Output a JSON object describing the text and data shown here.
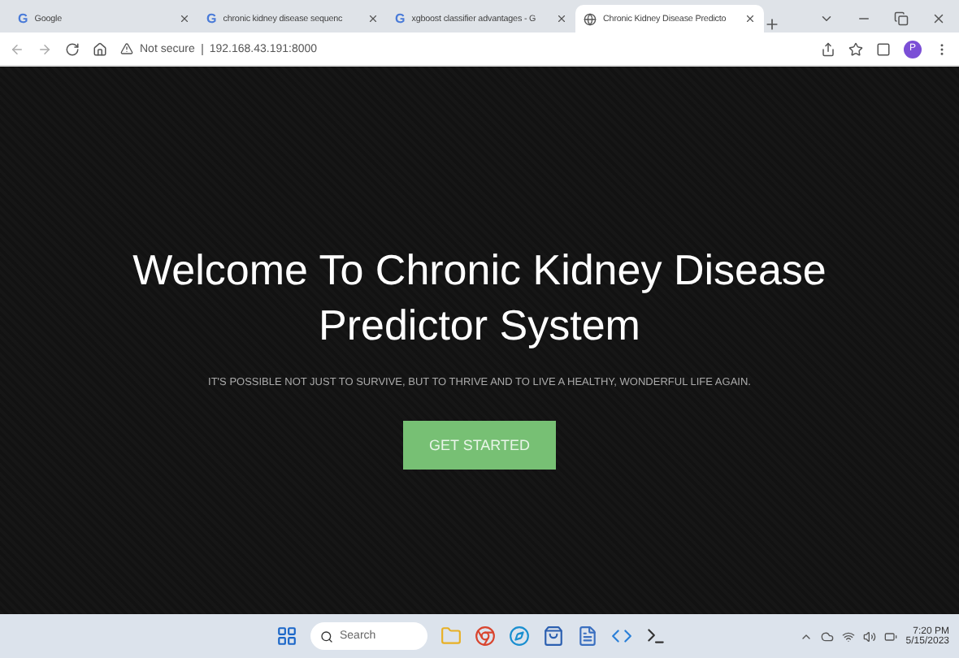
{
  "browser": {
    "tabs": [
      {
        "kind": "search",
        "favicon": "G",
        "title": "Google",
        "selected": false
      },
      {
        "kind": "search",
        "favicon": "G",
        "title": "chronic kidney disease sequenc",
        "selected": false
      },
      {
        "kind": "search",
        "favicon": "G",
        "title": "xgboost classifier advantages - G",
        "selected": false
      },
      {
        "kind": "site",
        "title": "Chronic Kidney Disease Predicto",
        "selected": true
      }
    ],
    "security": "Not secure",
    "address": "192.168.43.191:8000",
    "profile": "P"
  },
  "hero": {
    "title": "Welcome To Chronic Kidney Disease Predictor System",
    "subtitle": "IT'S POSSIBLE NOT JUST TO SURVIVE, BUT TO THRIVE AND TO LIVE A HEALTHY, WONDERFUL LIFE AGAIN.",
    "button": "GET STARTED"
  },
  "taskbar": {
    "search_placeholder": "Search",
    "time": "7:20 PM",
    "date": "5/15/2023"
  }
}
